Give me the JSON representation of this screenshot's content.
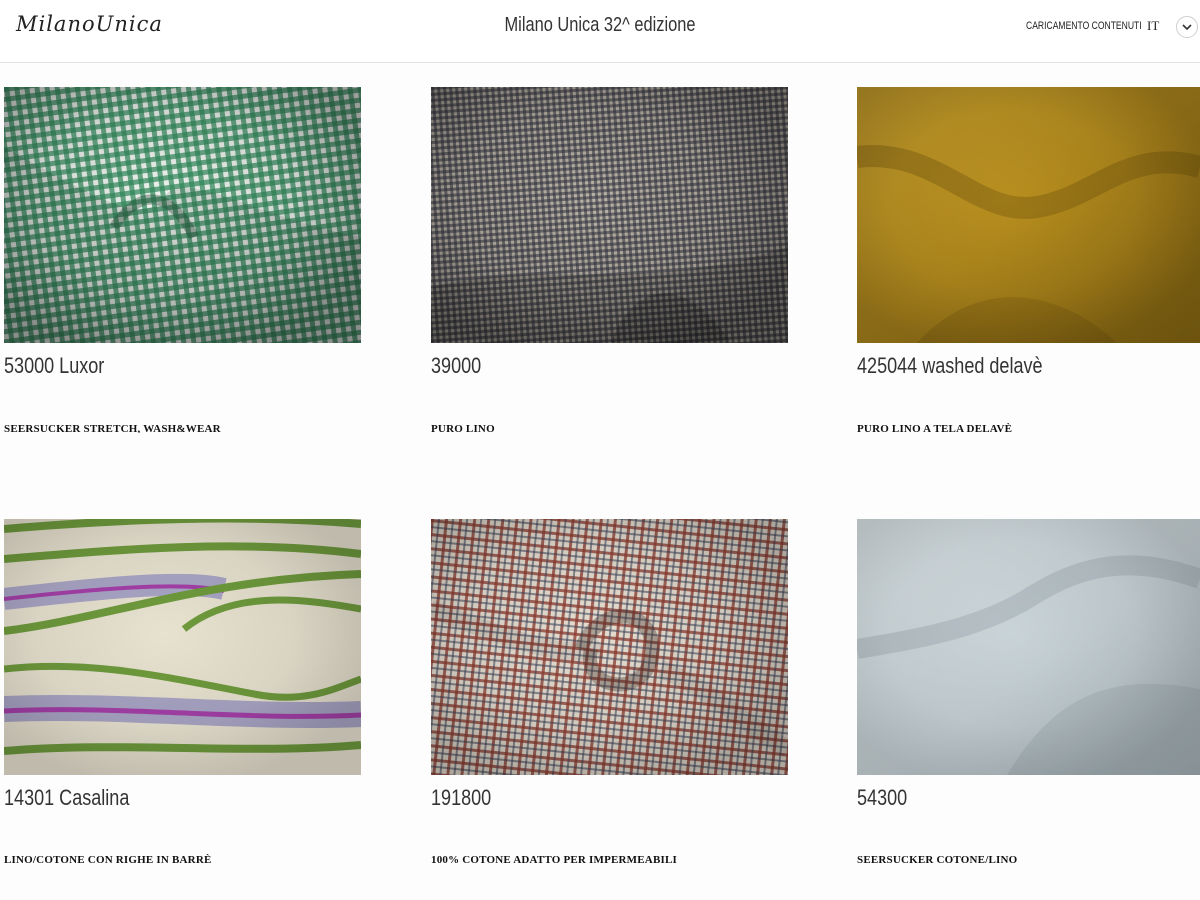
{
  "header": {
    "logo": "MilanoUnica",
    "title": "Milano Unica 32^ edizione",
    "upload_label": "Caricamento contenuti",
    "language": "IT",
    "toggle_icon": "chevron-down-icon"
  },
  "products": [
    {
      "code": "53000 Luxor",
      "description": "SEERSUCKER STRETCH, WASH&WEAR",
      "swatch": "green-white gingham"
    },
    {
      "code": "39000",
      "description": "PURO LINO",
      "swatch": "grey-navy micro check"
    },
    {
      "code": "425044 washed delavè",
      "description": "PURO LINO A TELA DELAVÈ",
      "swatch": "mustard linen"
    },
    {
      "code": "14301 Casalina",
      "description": "LINO/COTONE CON RIGHE IN BARRÈ",
      "swatch": "cream with green, purple and lilac stripes"
    },
    {
      "code": "191800",
      "description": "100% COTONE ADATTO PER IMPERMEABILI",
      "swatch": "red-navy-ecru check"
    },
    {
      "code": "54300",
      "description": "SEERSUCKER COTONE/LINO",
      "swatch": "pale blue-grey seersucker"
    }
  ],
  "colors": {
    "green_check": "#2f8a5c",
    "navy_check": "#2d2f3c",
    "mustard": "#b9901e",
    "stripe_green": "#6e9a3c",
    "stripe_purple": "#a43fa8",
    "stripe_lilac": "#a8a4c4",
    "red_check": "#8a3a30",
    "pale_blue": "#c9d3d6"
  }
}
